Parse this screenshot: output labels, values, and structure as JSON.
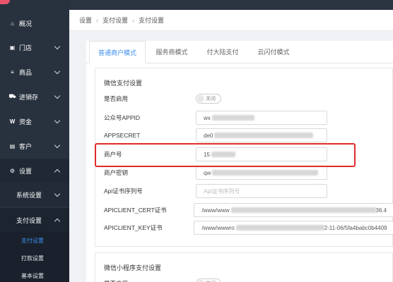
{
  "sidebar": {
    "items": [
      {
        "label": "概况",
        "icon": "home-icon",
        "glyph": "⌂"
      },
      {
        "label": "门店",
        "icon": "store-icon",
        "glyph": "▣"
      },
      {
        "label": "商品",
        "icon": "list-icon",
        "glyph": "≡"
      },
      {
        "label": "进销存",
        "icon": "truck-icon",
        "glyph": "⛟"
      },
      {
        "label": "资金",
        "icon": "money-icon",
        "glyph": "W"
      },
      {
        "label": "客户",
        "icon": "id-card-icon",
        "glyph": "▤"
      },
      {
        "label": "设置",
        "icon": "gear-icon",
        "glyph": "⚙"
      }
    ],
    "sub_items": [
      {
        "label": "系统设置"
      },
      {
        "label": "支付设置"
      }
    ],
    "leaves": [
      {
        "label": "支付设置"
      },
      {
        "label": "打款设置"
      },
      {
        "label": "基本设置"
      }
    ]
  },
  "breadcrumb": [
    "设置",
    "支付设置",
    "支付设置"
  ],
  "tabs": [
    "普通商户模式",
    "服务商模式",
    "付大陆支付",
    "云闪付模式"
  ],
  "wechat_pay": {
    "title": "微信支付设置",
    "enable_label": "是否启用",
    "toggle_text": "关闭",
    "fields": [
      {
        "label": "公众号APPID",
        "value": "wx"
      },
      {
        "label": "APPSECRET",
        "value": "de0"
      },
      {
        "label": "商户号",
        "value": "15"
      },
      {
        "label": "商户密钥",
        "value": "qw"
      },
      {
        "label": "Api证书序列号",
        "placeholder": "Api证书序列号"
      },
      {
        "label": "APICLIENT_CERT证书",
        "value": "/www/www",
        "suffix": "36.4"
      },
      {
        "label": "APICLIENT_KEY证书",
        "value": "/www/wwwro",
        "suffix": "2-11-06/5fa4babc0b4409"
      }
    ]
  },
  "mini_pay": {
    "title": "微信小程序支付设置",
    "toggle_text": "关闭"
  },
  "colors": {
    "sidebar": "#28323f",
    "accent": "#3b8fee",
    "highlight": "#e02a2a"
  }
}
